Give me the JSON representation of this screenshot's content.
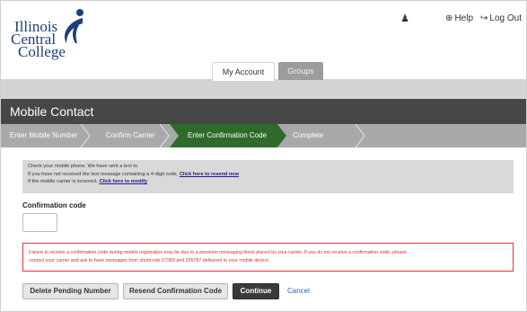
{
  "logo": {
    "line1": "Illinois",
    "line2": "Central",
    "line3": "College"
  },
  "top_links": {
    "user_icon": "user-icon",
    "help": "Help",
    "logout": "Log Out"
  },
  "tabs": [
    {
      "label": "My Account"
    },
    {
      "label": "Groups"
    }
  ],
  "page_title": "Mobile Contact",
  "steps": [
    {
      "label": "Enter Mobile Number"
    },
    {
      "label": "Confirm Carrier"
    },
    {
      "label": "Enter Confirmation Code"
    },
    {
      "label": "Complete"
    }
  ],
  "info": {
    "line1": "Check your mobile phone. We have sent a text to",
    "line2_prefix": "If you have not received the text message containing a 4-digit code,",
    "resend_link": "Click here to resend now",
    "line3_prefix": "If the mobile carrier is incorrect,",
    "modify_link": "Click here to modify"
  },
  "confirmation": {
    "label": "Confirmation code",
    "value": ""
  },
  "warning": {
    "line1": "Failure to receive a confirmation code during mobile registration may be due to a premium messaging block placed by your carrier. If you do not receive a confirmation code, please",
    "line2": "contact your carrier and ask to have messages from shortcode 67283 and 226787 delivered to your mobile device."
  },
  "buttons": {
    "delete": "Delete Pending Number",
    "resend": "Resend Confirmation Code",
    "continue": "Continue",
    "cancel": "Cancel"
  },
  "colors": {
    "active_step": "#2e6b2b",
    "step_bar": "#a9a9a9",
    "title_bar": "#474747",
    "warning": "#e33333",
    "link": "#2a63b8"
  }
}
